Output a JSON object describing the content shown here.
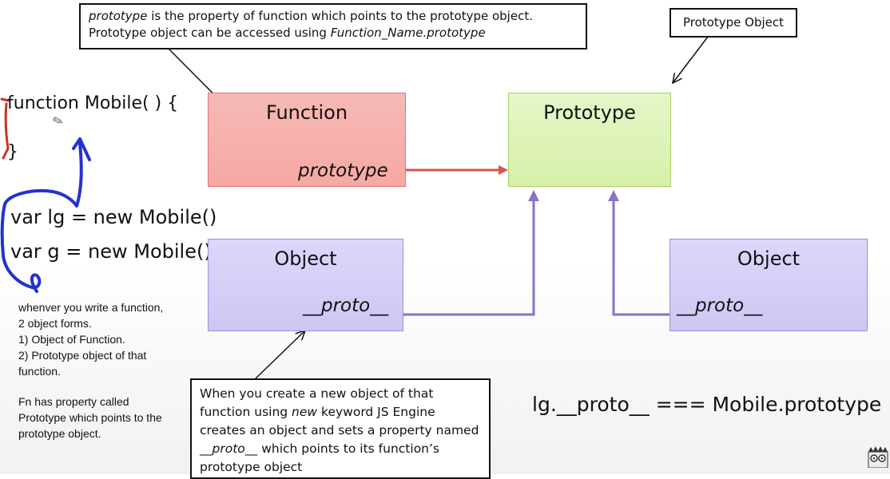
{
  "top_callout": {
    "line1_italic": "prototype",
    "line1_rest": " is the property of function which points to the prototype object.",
    "line2_text": "Prototype object can be accessed using ",
    "line2_italic": "Function_Name.prototype"
  },
  "proto_object_label": "Prototype Object",
  "code": {
    "line1": "function Mobile( ) {",
    "line2": "}",
    "line3": "var lg = new Mobile()",
    "line4": "var g = new Mobile()"
  },
  "function_box": {
    "title": "Function",
    "prop": "prototype"
  },
  "prototype_box": {
    "title": "Prototype"
  },
  "object_box_left": {
    "title": "Object",
    "prop": "__proto__"
  },
  "object_box_right": {
    "title": "Object",
    "prop": "__proto__"
  },
  "notes": {
    "line1": "whenver you write a function,",
    "line2": "2 object forms.",
    "line3": "1) Object of Function.",
    "line4": "2) Prototype object of that",
    "line5": "function.",
    "line6": "Fn has property called",
    "line7": "Prototype which points to the",
    "line8": "prototype object."
  },
  "bottom_callout": {
    "line1": "When you create a new object of that",
    "line2_a": "function using ",
    "line2_italic": "new",
    "line2_b": " keyword JS Engine",
    "line3": "creates an object and sets a property named",
    "line4_italic": "__proto__",
    "line4_b": " which points to its function’s",
    "line5": "prototype object"
  },
  "equation": "lg.__proto__ === Mobile.prototype",
  "colors": {
    "function_fill": "#f6aaa6",
    "prototype_fill": "#d9f1ad",
    "object_fill": "#d3cbf5",
    "fn_to_proto_arrow": "#d9534f",
    "obj_to_proto_arrow": "#8a72c6",
    "ink_blue": "#2233cc",
    "ink_red": "#cc3322"
  },
  "icons": [
    "pencil-cursor-icon",
    "mascot-icon"
  ]
}
